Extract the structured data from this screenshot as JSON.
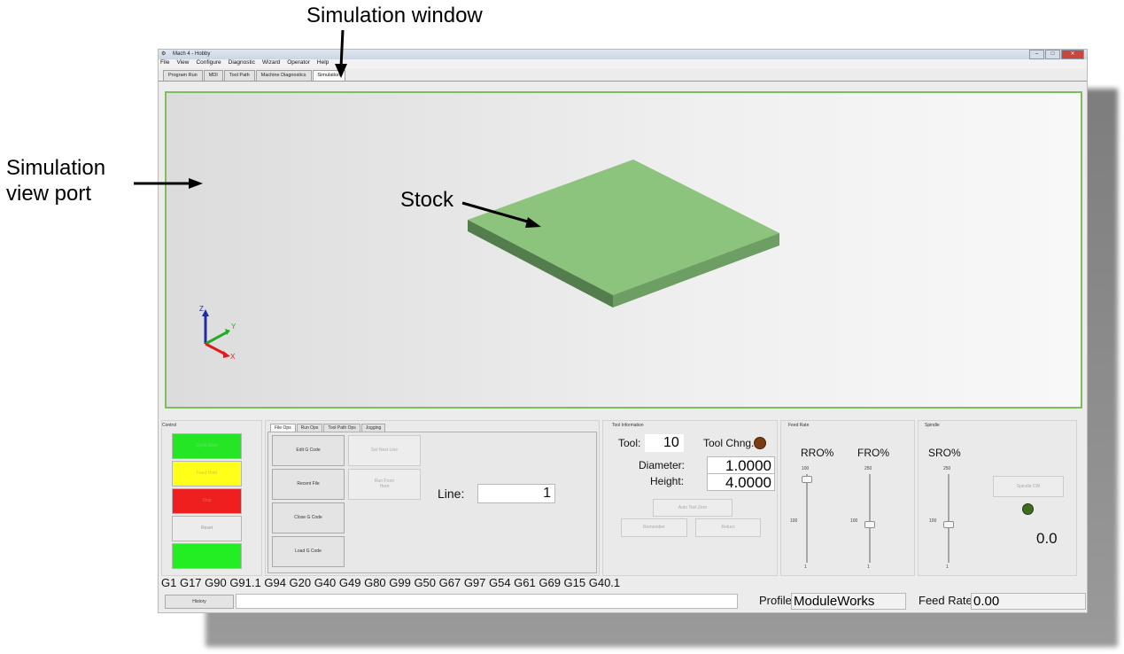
{
  "annotations": {
    "simulation_window": "Simulation window",
    "simulation_view_port_line1": "Simulation",
    "simulation_view_port_line2": "view port",
    "stock": "Stock"
  },
  "window": {
    "title": "Mach 4 - Hobby",
    "menu": [
      "File",
      "View",
      "Configure",
      "Diagnostic",
      "Wizard",
      "Operator",
      "Help"
    ],
    "tabs": [
      "Program Run",
      "MDI",
      "Tool Path",
      "Machine Diagnostics",
      "Simulation"
    ],
    "active_tab": "Simulation"
  },
  "viewport": {
    "axes": {
      "z": "Z",
      "y": "Y",
      "x": "X"
    },
    "stock_color": "#8cc47e"
  },
  "control": {
    "title": "Control",
    "buttons": [
      "Cycle Start",
      "Feed Hold",
      "Stop",
      "Reset",
      ""
    ],
    "colors": {
      "cycle_start": "#24e624",
      "feed_hold": "#ffff1a",
      "stop": "#ee1f1f",
      "reset": "#ececec",
      "bottom": "#22ee22"
    }
  },
  "file_ops": {
    "tabs": [
      "File Ops",
      "Run Ops",
      "Tool Path Ops",
      "Jogging"
    ],
    "buttons": {
      "edit_gcode": "Edit G Code",
      "recent_file": "Recent File",
      "close_gcode": "Close G Code",
      "load_gcode": "Load G Code",
      "set_next_line": "Set Next Line",
      "run_from_here_1": "Run From",
      "run_from_here_2": "Here"
    },
    "line_label": "Line:",
    "line_value": "1"
  },
  "tool_info": {
    "title": "Tool Information",
    "tool_label": "Tool:",
    "tool_value": "10",
    "tool_change_label": "Tool Chng.",
    "diameter_label": "Diameter:",
    "diameter_value": "1.0000",
    "height_label": "Height:",
    "height_value": "4.0000",
    "auto_tool_zero": "Auto Tool Zero",
    "remember": "Remember",
    "return": "Return"
  },
  "feed_rate": {
    "title": "Feed Rate",
    "rro_label": "RRO%",
    "fro_label": "FRO%",
    "rro_ticks": [
      "100",
      "100",
      "1"
    ],
    "fro_ticks": [
      "250",
      "100",
      "1"
    ],
    "rro_level": 100,
    "fro_level": 100
  },
  "spindle": {
    "title": "Spindle",
    "sro_label": "SRO%",
    "sro_ticks": [
      "250",
      "100",
      "1"
    ],
    "sro_level": 100,
    "spindle_cw": "Spindle CW",
    "rpm_value": "0.0"
  },
  "gcode_line": "G1 G17 G90 G91.1 G94 G20 G40 G49 G80 G99 G50 G67 G97 G54 G61 G69 G15 G40.1",
  "status": {
    "history_button": "History",
    "message": "",
    "profile_label": "Profile:",
    "profile_value": "ModuleWorks",
    "feed_rate_label": "Feed Rate:",
    "feed_rate_value": "0.00"
  }
}
